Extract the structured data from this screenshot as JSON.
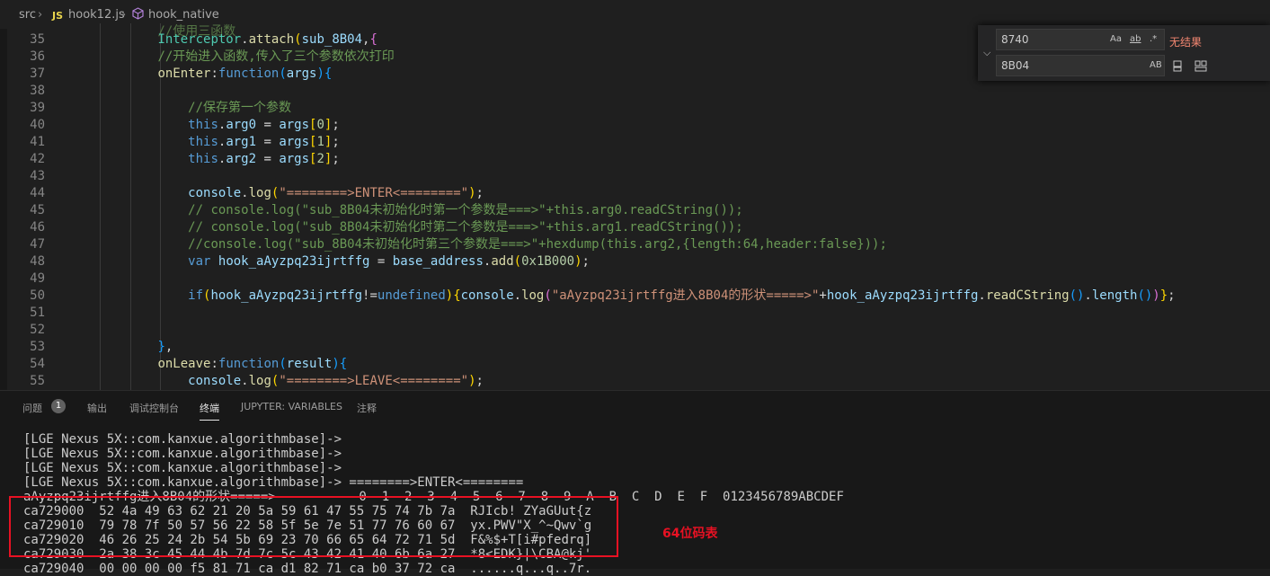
{
  "breadcrumb": {
    "folder": "src",
    "file_badge": "JS",
    "file": "hook12.js",
    "symbol": "hook_native"
  },
  "editor": {
    "lines": [
      {
        "n": "35",
        "c": [
          {
            "t": "        ",
            "k": "pl"
          },
          {
            "t": "Interceptor",
            "k": "ty"
          },
          {
            "t": ".",
            "k": "pl"
          },
          {
            "t": "attach",
            "k": "fn"
          },
          {
            "t": "(",
            "k": "br1"
          },
          {
            "t": "sub_8B04",
            "k": "id"
          },
          {
            "t": ",",
            "k": "pl"
          },
          {
            "t": "{",
            "k": "br2"
          }
        ]
      },
      {
        "n": "36",
        "c": [
          {
            "t": "        ",
            "k": "pl"
          },
          {
            "t": "//开始进入函数,传入了三个参数依次打印",
            "k": "cm"
          }
        ]
      },
      {
        "n": "37",
        "c": [
          {
            "t": "        ",
            "k": "pl"
          },
          {
            "t": "onEnter",
            "k": "fn"
          },
          {
            "t": ":",
            "k": "pl"
          },
          {
            "t": "function",
            "k": "kw"
          },
          {
            "t": "(",
            "k": "br3"
          },
          {
            "t": "args",
            "k": "id"
          },
          {
            "t": ")",
            "k": "br3"
          },
          {
            "t": "{",
            "k": "br3"
          }
        ]
      },
      {
        "n": "38",
        "c": []
      },
      {
        "n": "39",
        "c": [
          {
            "t": "            ",
            "k": "pl"
          },
          {
            "t": "//保存第一个参数",
            "k": "cm"
          }
        ]
      },
      {
        "n": "40",
        "c": [
          {
            "t": "            ",
            "k": "pl"
          },
          {
            "t": "this",
            "k": "kw"
          },
          {
            "t": ".",
            "k": "pl"
          },
          {
            "t": "arg0",
            "k": "id"
          },
          {
            "t": " = ",
            "k": "pl"
          },
          {
            "t": "args",
            "k": "id"
          },
          {
            "t": "[",
            "k": "br1"
          },
          {
            "t": "0",
            "k": "nm"
          },
          {
            "t": "]",
            "k": "br1"
          },
          {
            "t": ";",
            "k": "pl"
          }
        ]
      },
      {
        "n": "41",
        "c": [
          {
            "t": "            ",
            "k": "pl"
          },
          {
            "t": "this",
            "k": "kw"
          },
          {
            "t": ".",
            "k": "pl"
          },
          {
            "t": "arg1",
            "k": "id"
          },
          {
            "t": " = ",
            "k": "pl"
          },
          {
            "t": "args",
            "k": "id"
          },
          {
            "t": "[",
            "k": "br1"
          },
          {
            "t": "1",
            "k": "nm"
          },
          {
            "t": "]",
            "k": "br1"
          },
          {
            "t": ";",
            "k": "pl"
          }
        ]
      },
      {
        "n": "42",
        "c": [
          {
            "t": "            ",
            "k": "pl"
          },
          {
            "t": "this",
            "k": "kw"
          },
          {
            "t": ".",
            "k": "pl"
          },
          {
            "t": "arg2",
            "k": "id"
          },
          {
            "t": " = ",
            "k": "pl"
          },
          {
            "t": "args",
            "k": "id"
          },
          {
            "t": "[",
            "k": "br1"
          },
          {
            "t": "2",
            "k": "nm"
          },
          {
            "t": "]",
            "k": "br1"
          },
          {
            "t": ";",
            "k": "pl"
          }
        ]
      },
      {
        "n": "43",
        "c": []
      },
      {
        "n": "44",
        "c": [
          {
            "t": "            ",
            "k": "pl"
          },
          {
            "t": "console",
            "k": "id"
          },
          {
            "t": ".",
            "k": "pl"
          },
          {
            "t": "log",
            "k": "fn"
          },
          {
            "t": "(",
            "k": "br1"
          },
          {
            "t": "\"========>ENTER<========\"",
            "k": "st"
          },
          {
            "t": ")",
            "k": "br1"
          },
          {
            "t": ";",
            "k": "pl"
          }
        ]
      },
      {
        "n": "45",
        "c": [
          {
            "t": "            ",
            "k": "pl"
          },
          {
            "t": "// console.log(\"sub_8B04未初始化时第一个参数是===>\"+this.arg0.readCString());",
            "k": "cm"
          }
        ]
      },
      {
        "n": "46",
        "c": [
          {
            "t": "            ",
            "k": "pl"
          },
          {
            "t": "// console.log(\"sub_8B04未初始化时第二个参数是===>\"+this.arg1.readCString());",
            "k": "cm"
          }
        ]
      },
      {
        "n": "47",
        "c": [
          {
            "t": "            ",
            "k": "pl"
          },
          {
            "t": "//console.log(\"sub_8B04未初始化时第三个参数是===>\"+hexdump(this.arg2,{length:64,header:false}));",
            "k": "cm"
          }
        ]
      },
      {
        "n": "48",
        "c": [
          {
            "t": "            ",
            "k": "pl"
          },
          {
            "t": "var",
            "k": "kw"
          },
          {
            "t": " ",
            "k": "pl"
          },
          {
            "t": "hook_aAyzpq23ijrtffg",
            "k": "id"
          },
          {
            "t": " = ",
            "k": "pl"
          },
          {
            "t": "base_address",
            "k": "id"
          },
          {
            "t": ".",
            "k": "pl"
          },
          {
            "t": "add",
            "k": "fn"
          },
          {
            "t": "(",
            "k": "br1"
          },
          {
            "t": "0x1B000",
            "k": "nm"
          },
          {
            "t": ")",
            "k": "br1"
          },
          {
            "t": ";",
            "k": "pl"
          }
        ]
      },
      {
        "n": "49",
        "c": []
      },
      {
        "n": "50",
        "c": [
          {
            "t": "            ",
            "k": "pl"
          },
          {
            "t": "if",
            "k": "kw"
          },
          {
            "t": "(",
            "k": "br1"
          },
          {
            "t": "hook_aAyzpq23ijrtffg",
            "k": "id"
          },
          {
            "t": "!=",
            "k": "pl"
          },
          {
            "t": "undefined",
            "k": "kw"
          },
          {
            "t": ")",
            "k": "br1"
          },
          {
            "t": "{",
            "k": "br1"
          },
          {
            "t": "console",
            "k": "id"
          },
          {
            "t": ".",
            "k": "pl"
          },
          {
            "t": "log",
            "k": "fn"
          },
          {
            "t": "(",
            "k": "br2"
          },
          {
            "t": "\"aAyzpq23ijrtffg进入8B04的形状=====>\"",
            "k": "st"
          },
          {
            "t": "+",
            "k": "pl"
          },
          {
            "t": "hook_aAyzpq23ijrtffg",
            "k": "id"
          },
          {
            "t": ".",
            "k": "pl"
          },
          {
            "t": "readCString",
            "k": "fn"
          },
          {
            "t": "()",
            "k": "br3"
          },
          {
            "t": ".",
            "k": "pl"
          },
          {
            "t": "length",
            "k": "id"
          },
          {
            "t": "()",
            "k": "br3"
          },
          {
            "t": ")",
            "k": "br2"
          },
          {
            "t": "}",
            "k": "br1"
          },
          {
            "t": ";",
            "k": "pl"
          }
        ]
      },
      {
        "n": "51",
        "c": []
      },
      {
        "n": "52",
        "c": []
      },
      {
        "n": "53",
        "c": [
          {
            "t": "        ",
            "k": "pl"
          },
          {
            "t": "}",
            "k": "br3"
          },
          {
            "t": ",",
            "k": "pl"
          }
        ]
      },
      {
        "n": "54",
        "c": [
          {
            "t": "        ",
            "k": "pl"
          },
          {
            "t": "onLeave",
            "k": "fn"
          },
          {
            "t": ":",
            "k": "pl"
          },
          {
            "t": "function",
            "k": "kw"
          },
          {
            "t": "(",
            "k": "br3"
          },
          {
            "t": "result",
            "k": "id"
          },
          {
            "t": ")",
            "k": "br3"
          },
          {
            "t": "{",
            "k": "br3"
          }
        ]
      },
      {
        "n": "55",
        "c": [
          {
            "t": "            ",
            "k": "pl"
          },
          {
            "t": "console",
            "k": "id"
          },
          {
            "t": ".",
            "k": "pl"
          },
          {
            "t": "log",
            "k": "fn"
          },
          {
            "t": "(",
            "k": "br1"
          },
          {
            "t": "\"========>LEAVE<========\"",
            "k": "st"
          },
          {
            "t": ")",
            "k": "br1"
          },
          {
            "t": ";",
            "k": "pl"
          }
        ]
      }
    ]
  },
  "find_widget": {
    "search_value": "8740",
    "replace_value": "8B04",
    "match_case": "Aa",
    "whole_word": "ab",
    "regex": ".*",
    "preserve_case": "AB",
    "no_results": "无结果"
  },
  "panel": {
    "tabs": [
      {
        "label": "问题",
        "name": "tab-problems"
      },
      {
        "label": "输出",
        "name": "tab-output"
      },
      {
        "label": "调试控制台",
        "name": "tab-debug-console"
      },
      {
        "label": "终端",
        "name": "tab-terminal"
      },
      {
        "label": "JUPYTER: VARIABLES",
        "name": "tab-jupyter-variables"
      },
      {
        "label": "注释",
        "name": "tab-comments"
      }
    ],
    "problems_count": "1",
    "terminal_lines": [
      "[LGE Nexus 5X::com.kanxue.algorithmbase]->",
      "[LGE Nexus 5X::com.kanxue.algorithmbase]->",
      "[LGE Nexus 5X::com.kanxue.algorithmbase]->",
      "[LGE Nexus 5X::com.kanxue.algorithmbase]-> ========>ENTER<========",
      "aAyzpq23ijrtffg进入8B04的形状=====>           0  1  2  3  4  5  6  7  8  9  A  B  C  D  E  F  0123456789ABCDEF",
      "ca729000  52 4a 49 63 62 21 20 5a 59 61 47 55 75 74 7b 7a  RJIcb! ZYaGUut{z",
      "ca729010  79 78 7f 50 57 56 22 58 5f 5e 7e 51 77 76 60 67  yx.PWV\"X_^~Qwv`g",
      "ca729020  46 26 25 24 2b 54 5b 69 23 70 66 65 64 72 71 5d  F&%$+T[i#pfedrq]",
      "ca729030  2a 38 3c 45 44 4b 7d 7c 5c 43 42 41 40 6b 6a 27  *8<EDK}|\\CBA@kj'",
      "ca729040  00 00 00 00 f5 81 71 ca d1 82 71 ca b0 37 72 ca  ......q...q..7r."
    ]
  },
  "annotation": {
    "label": "64位码表",
    "color": "#e81123"
  }
}
